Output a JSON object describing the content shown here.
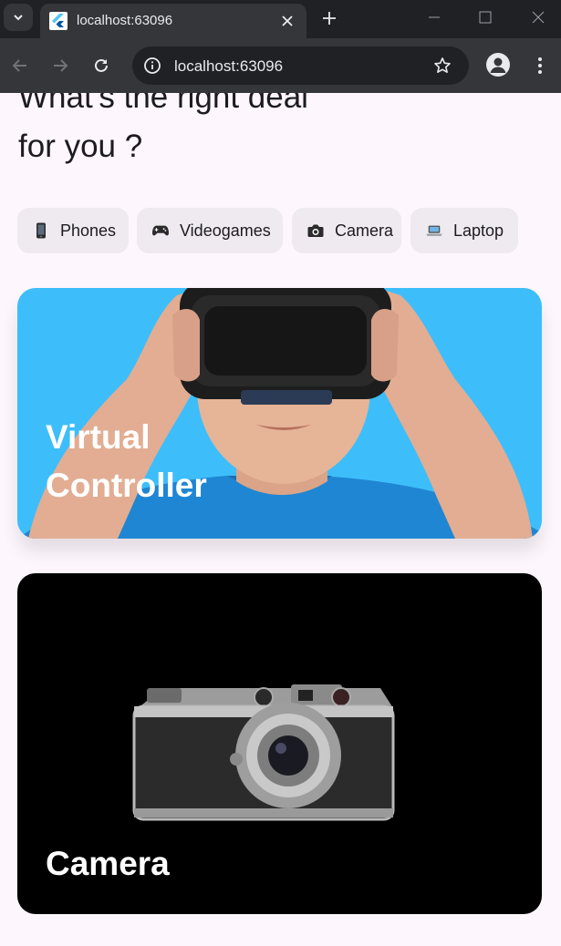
{
  "browser": {
    "tab_title": "localhost:63096",
    "url": "localhost:63096",
    "icons": {
      "tab_menu": "chevron-down-icon",
      "favicon": "flutter-logo-icon",
      "close": "close-icon",
      "new_tab": "plus-icon",
      "minimize": "minimize-icon",
      "maximize": "maximize-icon",
      "window_close": "close-icon",
      "back": "arrow-left-icon",
      "forward": "arrow-right-icon",
      "reload": "reload-icon",
      "site_info": "info-icon",
      "bookmark": "star-icon",
      "profile": "person-icon",
      "menu": "more-vert-icon"
    }
  },
  "page": {
    "headline": "What's the right deal for you ?",
    "categories": [
      {
        "label": "Phones",
        "icon": "phone-icon"
      },
      {
        "label": "Videogames",
        "icon": "gamepad-icon"
      },
      {
        "label": "Camera",
        "icon": "camera-icon"
      },
      {
        "label": "Laptop",
        "icon": "laptop-icon"
      }
    ],
    "cards": [
      {
        "title": "Virtual Controller",
        "background": "#3dbefa"
      },
      {
        "title": "Camera",
        "background": "#000000"
      }
    ]
  },
  "colors": {
    "page_background": "#fdf7fd",
    "chip_background": "#eeeaef",
    "chrome_dark": "#202124",
    "chrome_mid": "#35363a"
  }
}
